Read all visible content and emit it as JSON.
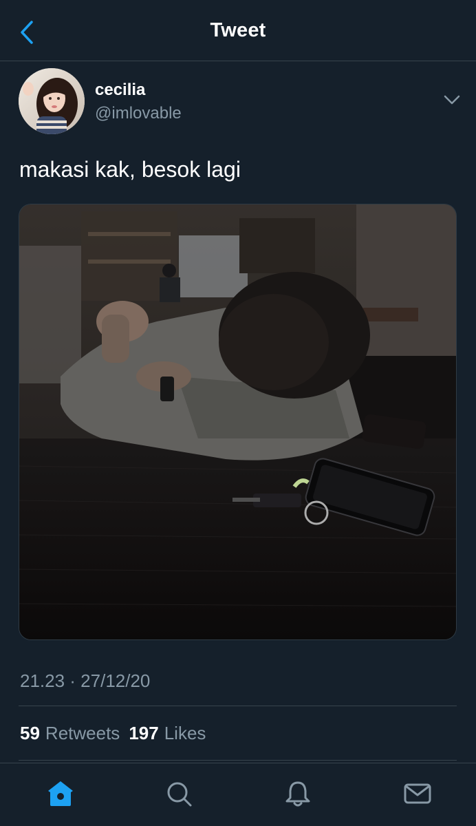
{
  "header": {
    "title": "Tweet",
    "back_icon": "chevron-left-icon"
  },
  "author": {
    "name": "cecilia",
    "handle": "@imlovable"
  },
  "tweet": {
    "text": "makasi kak, besok lagi",
    "timestamp": "21.23 · 27/12/20",
    "retweets": {
      "count": "59",
      "label": "Retweets"
    },
    "likes": {
      "count": "197",
      "label": "Likes"
    }
  },
  "tabbar": {
    "items": [
      {
        "name": "home-icon",
        "active": true
      },
      {
        "name": "search-icon",
        "active": false
      },
      {
        "name": "notifications-icon",
        "active": false
      },
      {
        "name": "messages-icon",
        "active": false
      }
    ]
  },
  "colors": {
    "background": "#15202b",
    "accent": "#1da1f2",
    "secondary_text": "#8899a6",
    "divider": "#38444d"
  }
}
